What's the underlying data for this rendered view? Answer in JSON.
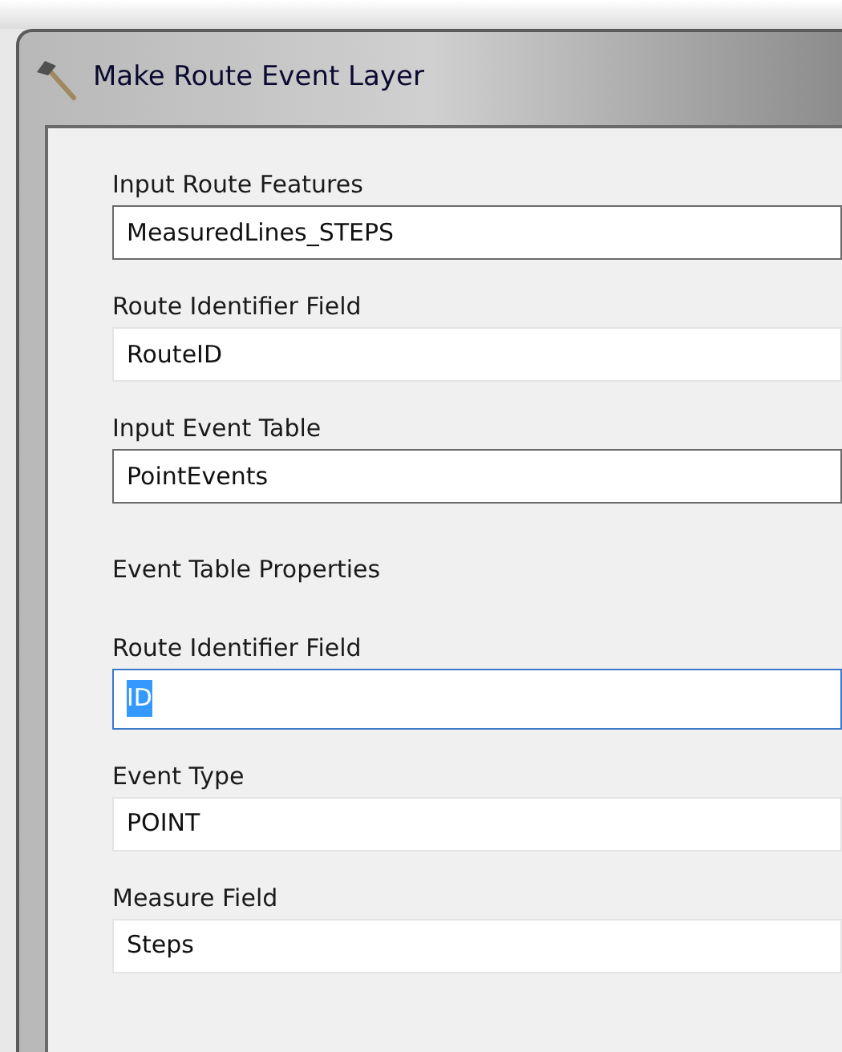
{
  "window": {
    "title": "Make Route Event Layer"
  },
  "items": [
    {
      "kind": "input",
      "label": "Input Route Features",
      "value": "MeasuredLines_STEPS",
      "focused": false
    },
    {
      "kind": "dropdown",
      "label": "Route Identifier Field",
      "value": "RouteID",
      "focused": false
    },
    {
      "kind": "input",
      "label": "Input Event Table",
      "value": "PointEvents",
      "focused": false
    },
    {
      "kind": "heading",
      "label": "Event Table Properties"
    },
    {
      "kind": "dropdown",
      "label": "Route Identifier Field",
      "value": "ID",
      "focused": true
    },
    {
      "kind": "dropdown",
      "label": "Event Type",
      "value": "POINT",
      "focused": false
    },
    {
      "kind": "dropdown",
      "label": "Measure Field",
      "value": "Steps",
      "focused": false
    }
  ]
}
